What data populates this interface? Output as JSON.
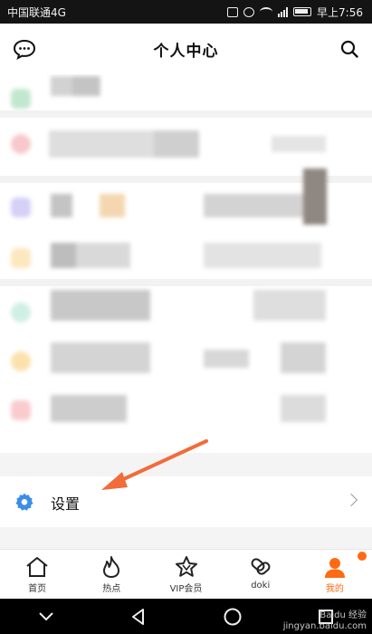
{
  "status_bar": {
    "carrier": "中国联通4G",
    "time": "早上7:56"
  },
  "header": {
    "title": "个人中心"
  },
  "settings": {
    "label": "设置"
  },
  "tabs": [
    {
      "label": "首页",
      "icon": "home-icon"
    },
    {
      "label": "热点",
      "icon": "flame-icon"
    },
    {
      "label": "VIP会员",
      "icon": "vip-star-icon"
    },
    {
      "label": "doki",
      "icon": "doki-icon"
    },
    {
      "label": "我的",
      "icon": "profile-icon"
    }
  ],
  "watermark": {
    "line1": "Baidu 经验",
    "line2": "jingyan.baidu.com"
  },
  "colors": {
    "accent": "#ff6a12",
    "arrow": "#f26b3a",
    "gear": "#3a8ee6"
  }
}
